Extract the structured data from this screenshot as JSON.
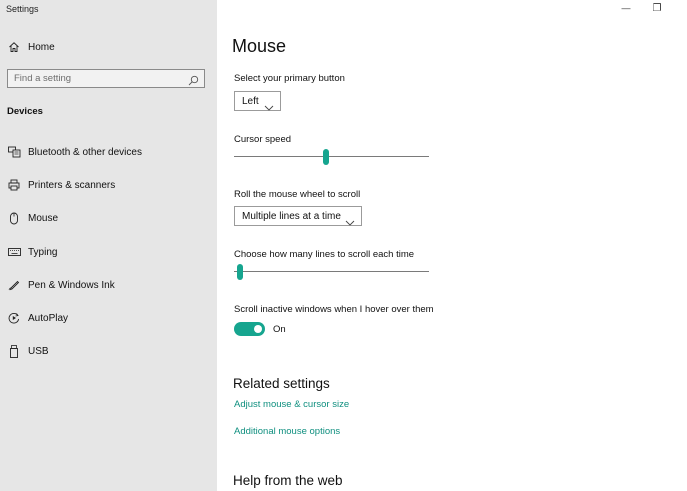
{
  "window": {
    "title": "Settings",
    "minimize_glyph": "—",
    "restore_glyph": "❐"
  },
  "sidebar": {
    "home_label": "Home",
    "search": {
      "placeholder": "Find a setting"
    },
    "section_label": "Devices",
    "items": [
      {
        "label": "Bluetooth & other devices",
        "icon": "keyboard-bluetooth-icon"
      },
      {
        "label": "Printers & scanners",
        "icon": "printer-icon"
      },
      {
        "label": "Mouse",
        "icon": "mouse-icon"
      },
      {
        "label": "Typing",
        "icon": "keyboard-icon"
      },
      {
        "label": "Pen & Windows Ink",
        "icon": "pen-icon"
      },
      {
        "label": "AutoPlay",
        "icon": "autoplay-icon"
      },
      {
        "label": "USB",
        "icon": "usb-icon"
      }
    ]
  },
  "main": {
    "title": "Mouse",
    "primary_button": {
      "label": "Select your primary button",
      "value": "Left"
    },
    "cursor_speed": {
      "label": "Cursor speed",
      "value": 0.47
    },
    "scroll_wheel": {
      "label": "Roll the mouse wheel to scroll",
      "value": "Multiple lines at a time"
    },
    "scroll_lines": {
      "label": "Choose how many lines to scroll each time",
      "value": 0.03
    },
    "inactive_scroll": {
      "label": "Scroll inactive windows when I hover over them",
      "state": "On",
      "on": true
    },
    "related": {
      "heading": "Related settings",
      "links": [
        "Adjust mouse & cursor size",
        "Additional mouse options"
      ]
    },
    "help_heading": "Help from the web"
  },
  "colors": {
    "accent": "#16a58f",
    "link": "#0f8f7f",
    "sidebar_bg": "#e6e6e6"
  }
}
